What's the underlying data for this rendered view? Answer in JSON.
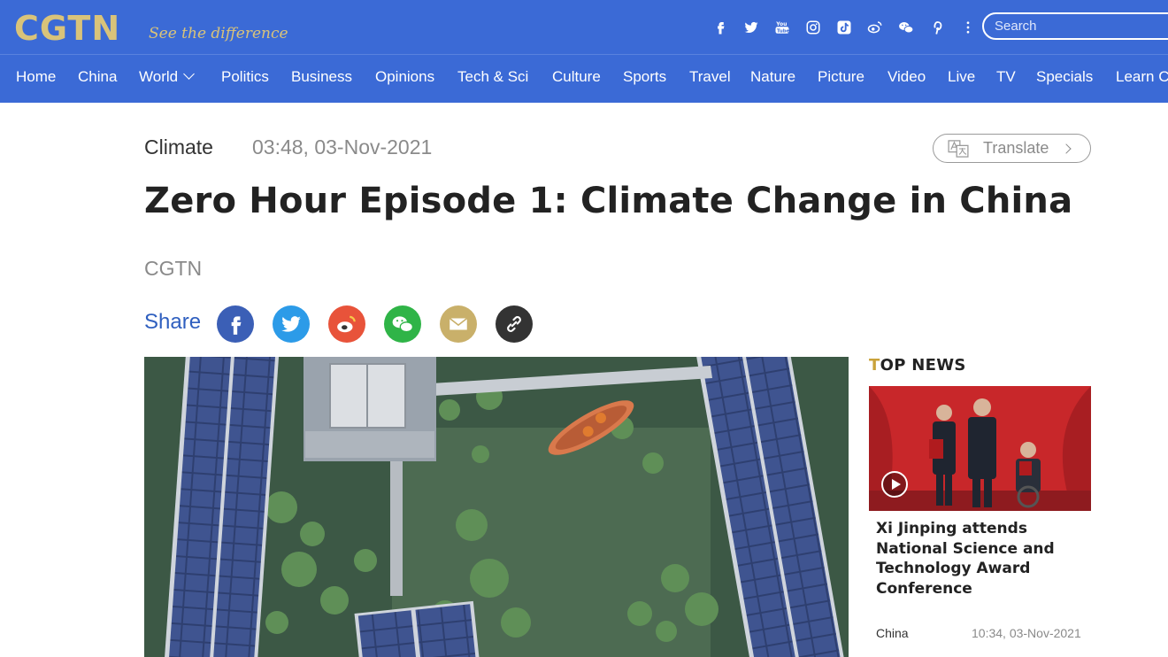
{
  "header": {
    "logo": "CGTN",
    "tagline": "See the difference",
    "social": [
      "facebook-icon",
      "twitter-icon",
      "youtube-icon",
      "instagram-icon",
      "tiktok-icon",
      "weibo-icon",
      "wechat-icon",
      "pinterest-icon",
      "more-icon"
    ],
    "search_placeholder": "Search",
    "brand_color": "#3b6ad6",
    "logo_color": "#d9c37a"
  },
  "nav": {
    "items": [
      "Home",
      "China",
      "World",
      "Politics",
      "Business",
      "Opinions",
      "Tech & Sci",
      "Culture",
      "Sports",
      "Travel",
      "Nature",
      "Picture",
      "Video",
      "Live",
      "TV",
      "Specials",
      "Learn C"
    ]
  },
  "article": {
    "category": "Climate",
    "datetime": "03:48, 03-Nov-2021",
    "translate_label": "Translate",
    "title": "Zero Hour Episode 1: Climate Change in China",
    "source": "CGTN",
    "share_label": "Share",
    "share_icons": [
      "facebook-icon",
      "twitter-icon",
      "weibo-icon",
      "wechat-icon",
      "email-icon",
      "link-icon"
    ]
  },
  "top_news": {
    "title_first": "T",
    "title_rest": "OP NEWS",
    "items": [
      {
        "headline": "Xi Jinping attends National Science and Technology Award Conference",
        "category": "China",
        "time": "10:34, 03-Nov-2021"
      }
    ]
  }
}
